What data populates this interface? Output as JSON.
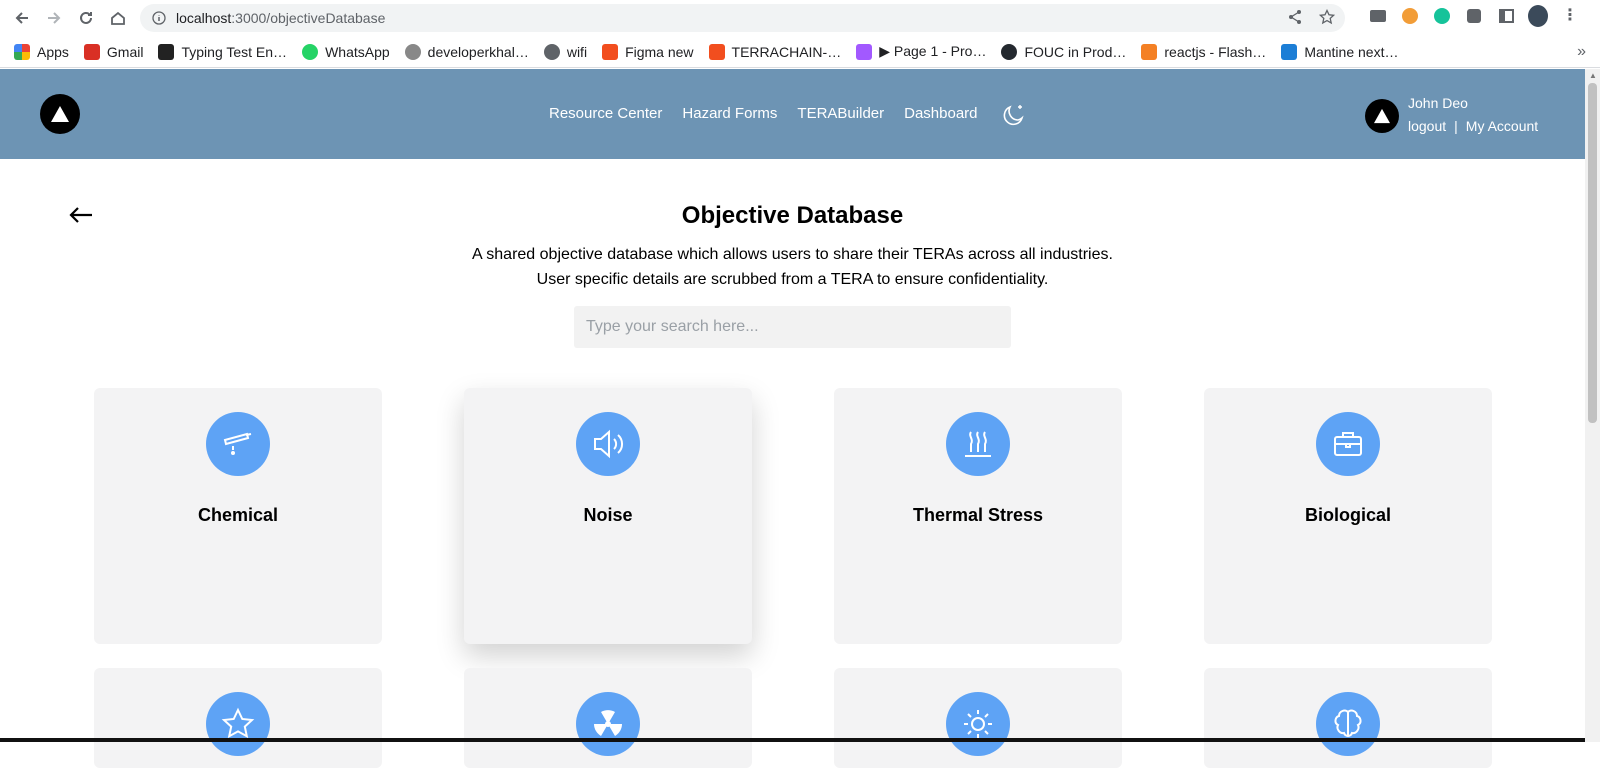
{
  "browser": {
    "url_host": "localhost",
    "url_path": ":3000/objectiveDatabase",
    "bookmarks": [
      {
        "label": "Apps",
        "color": "#ea4335"
      },
      {
        "label": "Gmail",
        "color": "#d93025"
      },
      {
        "label": "Typing Test En…",
        "color": "#222222"
      },
      {
        "label": "WhatsApp",
        "color": "#25d366"
      },
      {
        "label": "developerkhal…",
        "color": "#888888"
      },
      {
        "label": "wifi",
        "color": "#5f6368"
      },
      {
        "label": "Figma new",
        "color": "#f24e1e"
      },
      {
        "label": "TERRACHAIN-…",
        "color": "#f24e1e"
      },
      {
        "label": "▶ Page 1 - Pro…",
        "color": "#a259ff"
      },
      {
        "label": "FOUC in Prod…",
        "color": "#24292f"
      },
      {
        "label": "reactjs - Flash…",
        "color": "#f48024"
      },
      {
        "label": "Mantine next…",
        "color": "#1c7ed6"
      }
    ],
    "more": "»"
  },
  "header": {
    "nav": [
      "Resource Center",
      "Hazard Forms",
      "TERABuilder",
      "Dashboard"
    ],
    "user_name": "John Deo",
    "logout": "logout",
    "separator": "|",
    "my_account": "My Account"
  },
  "main": {
    "title": "Objective Database",
    "description": "A shared objective database which allows users to share their TERAs across all industries. User specific details are scrubbed from a TERA to ensure confidentiality.",
    "search_placeholder": "Type your search here...",
    "cards": [
      {
        "label": "Chemical",
        "icon": "test-tube-icon"
      },
      {
        "label": "Noise",
        "icon": "speaker-icon"
      },
      {
        "label": "Thermal Stress",
        "icon": "heat-icon"
      },
      {
        "label": "Biological",
        "icon": "briefcase-icon"
      },
      {
        "label": "",
        "icon": "star-icon"
      },
      {
        "label": "",
        "icon": "radiation-icon"
      },
      {
        "label": "",
        "icon": "sun-icon"
      },
      {
        "label": "",
        "icon": "brain-icon"
      }
    ]
  },
  "colors": {
    "header_bg": "#6d94b4",
    "icon_circle": "#5ea3f5",
    "card_bg": "#f3f3f4"
  }
}
